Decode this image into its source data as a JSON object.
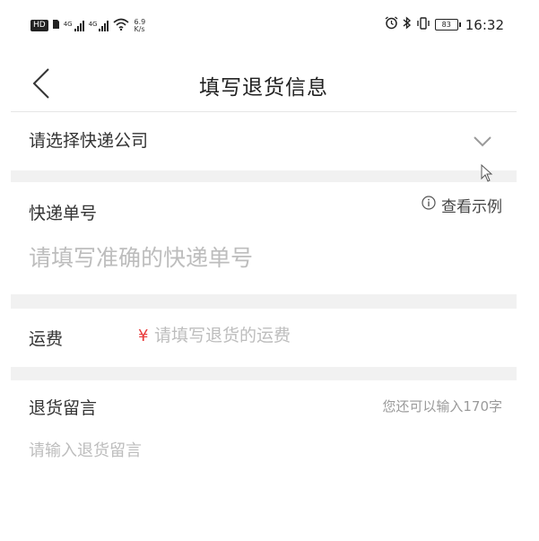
{
  "status_bar": {
    "left_icons": [
      "hd-badge-icon",
      "sim-card-icon",
      "signal-icon",
      "signal-icon",
      "wifi-icon"
    ],
    "hd_label": "HD",
    "signal_1_label": "4G",
    "signal_2_label": "4G",
    "net_speed_value": "6.9",
    "net_speed_unit": "K/s",
    "right_icons": [
      "alarm-icon",
      "bluetooth-icon",
      "vibrate-icon",
      "battery-icon"
    ],
    "battery_level": "83",
    "time": "16:32"
  },
  "nav": {
    "title": "填写退货信息",
    "back_icon": "chevron-left-icon"
  },
  "courier": {
    "placeholder": "请选择快递公司",
    "icon": "chevron-down-icon"
  },
  "tracking": {
    "label": "快递单号",
    "example_link": "查看示例",
    "example_icon": "info-icon",
    "placeholder": "请填写准确的快递单号",
    "value": ""
  },
  "freight": {
    "label": "运费",
    "currency_symbol": "¥",
    "placeholder": "请填写退货的运费",
    "value": "",
    "accent_color": "#e93b3b"
  },
  "message": {
    "label": "退货留言",
    "counter_text": "您还可以输入170字",
    "placeholder": "请输入退货留言",
    "value": ""
  },
  "colors": {
    "page_background": "#f1f1f1",
    "placeholder_text": "#bdbdbd",
    "counter_text": "#9a9a9a"
  }
}
